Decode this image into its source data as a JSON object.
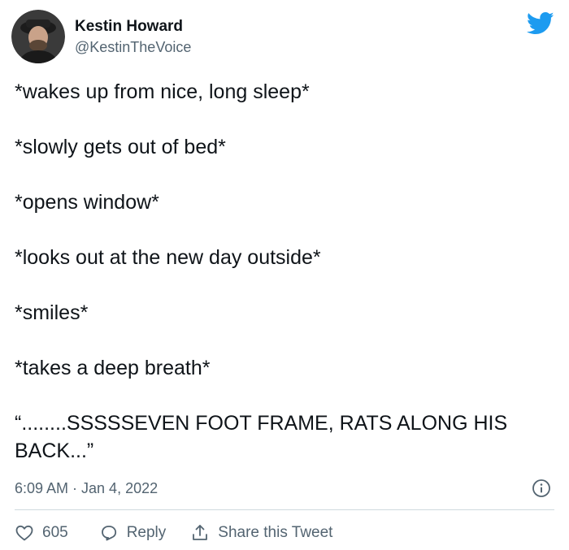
{
  "author": {
    "display_name": "Kestin Howard",
    "handle": "@KestinTheVoice"
  },
  "tweet": {
    "lines": [
      "*wakes up from nice, long sleep*",
      "*slowly gets out of bed*",
      "*opens window*",
      "*looks out at the new day outside*",
      "*smiles*",
      "*takes a deep breath*",
      "“........SSSSSEVEN FOOT FRAME, RATS ALONG HIS BACK...”"
    ],
    "timestamp": "6:09 AM · Jan 4, 2022"
  },
  "actions": {
    "like_count": "605",
    "reply_label": "Reply",
    "share_label": "Share this Tweet"
  },
  "icons": {
    "brand": "twitter-bird-icon",
    "info": "info-icon",
    "like": "heart-icon",
    "reply": "reply-bubble-icon",
    "share": "share-upload-icon"
  },
  "colors": {
    "twitter_blue": "#1d9bf0",
    "secondary_text": "#536471",
    "primary_text": "#0f1419",
    "divider": "#cfd9de"
  }
}
